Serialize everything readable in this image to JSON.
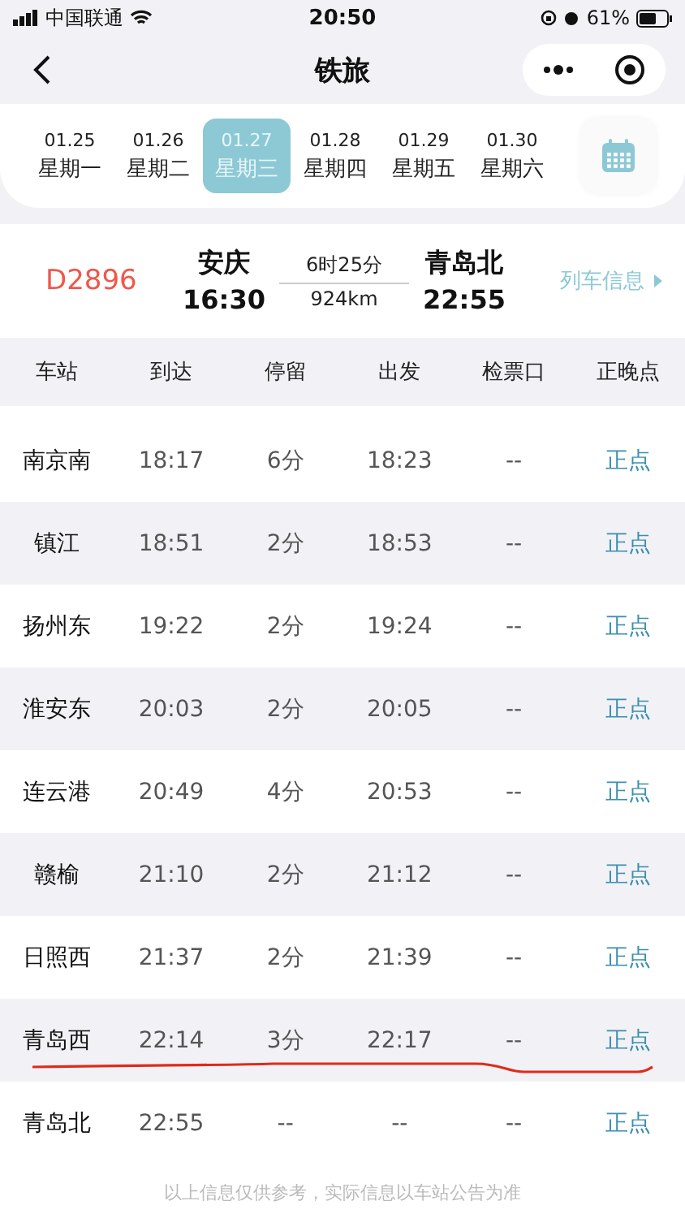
{
  "status_bar": {
    "carrier": "中国联通",
    "time": "20:50",
    "battery": "61%"
  },
  "nav": {
    "title": "铁旅"
  },
  "dates": [
    {
      "date": "01.25",
      "weekday": "星期一",
      "selected": false
    },
    {
      "date": "01.26",
      "weekday": "星期二",
      "selected": false
    },
    {
      "date": "01.27",
      "weekday": "星期三",
      "selected": true
    },
    {
      "date": "01.28",
      "weekday": "星期四",
      "selected": false
    },
    {
      "date": "01.29",
      "weekday": "星期五",
      "selected": false
    },
    {
      "date": "01.30",
      "weekday": "星期六",
      "selected": false
    }
  ],
  "train": {
    "number": "D2896",
    "from": "安庆",
    "depart": "16:30",
    "duration": "6时25分",
    "distance": "924km",
    "to": "青岛北",
    "arrive": "22:55",
    "info_link": "列车信息"
  },
  "table": {
    "columns": [
      "车站",
      "到达",
      "停留",
      "出发",
      "检票口",
      "正晚点"
    ],
    "rows": [
      {
        "cells": [
          "南京南",
          "18:17",
          "6分",
          "18:23",
          "--",
          "正点"
        ],
        "underlined": false
      },
      {
        "cells": [
          "镇江",
          "18:51",
          "2分",
          "18:53",
          "--",
          "正点"
        ],
        "underlined": false
      },
      {
        "cells": [
          "扬州东",
          "19:22",
          "2分",
          "19:24",
          "--",
          "正点"
        ],
        "underlined": false
      },
      {
        "cells": [
          "淮安东",
          "20:03",
          "2分",
          "20:05",
          "--",
          "正点"
        ],
        "underlined": false
      },
      {
        "cells": [
          "连云港",
          "20:49",
          "4分",
          "20:53",
          "--",
          "正点"
        ],
        "underlined": false
      },
      {
        "cells": [
          "赣榆",
          "21:10",
          "2分",
          "21:12",
          "--",
          "正点"
        ],
        "underlined": false
      },
      {
        "cells": [
          "日照西",
          "21:37",
          "2分",
          "21:39",
          "--",
          "正点"
        ],
        "underlined": false
      },
      {
        "cells": [
          "青岛西",
          "22:14",
          "3分",
          "22:17",
          "--",
          "正点"
        ],
        "underlined": true
      },
      {
        "cells": [
          "青岛北",
          "22:55",
          "--",
          "--",
          "--",
          "正点"
        ],
        "underlined": false
      }
    ]
  },
  "footnote": "以上信息仅供参考，实际信息以车站公告为准"
}
